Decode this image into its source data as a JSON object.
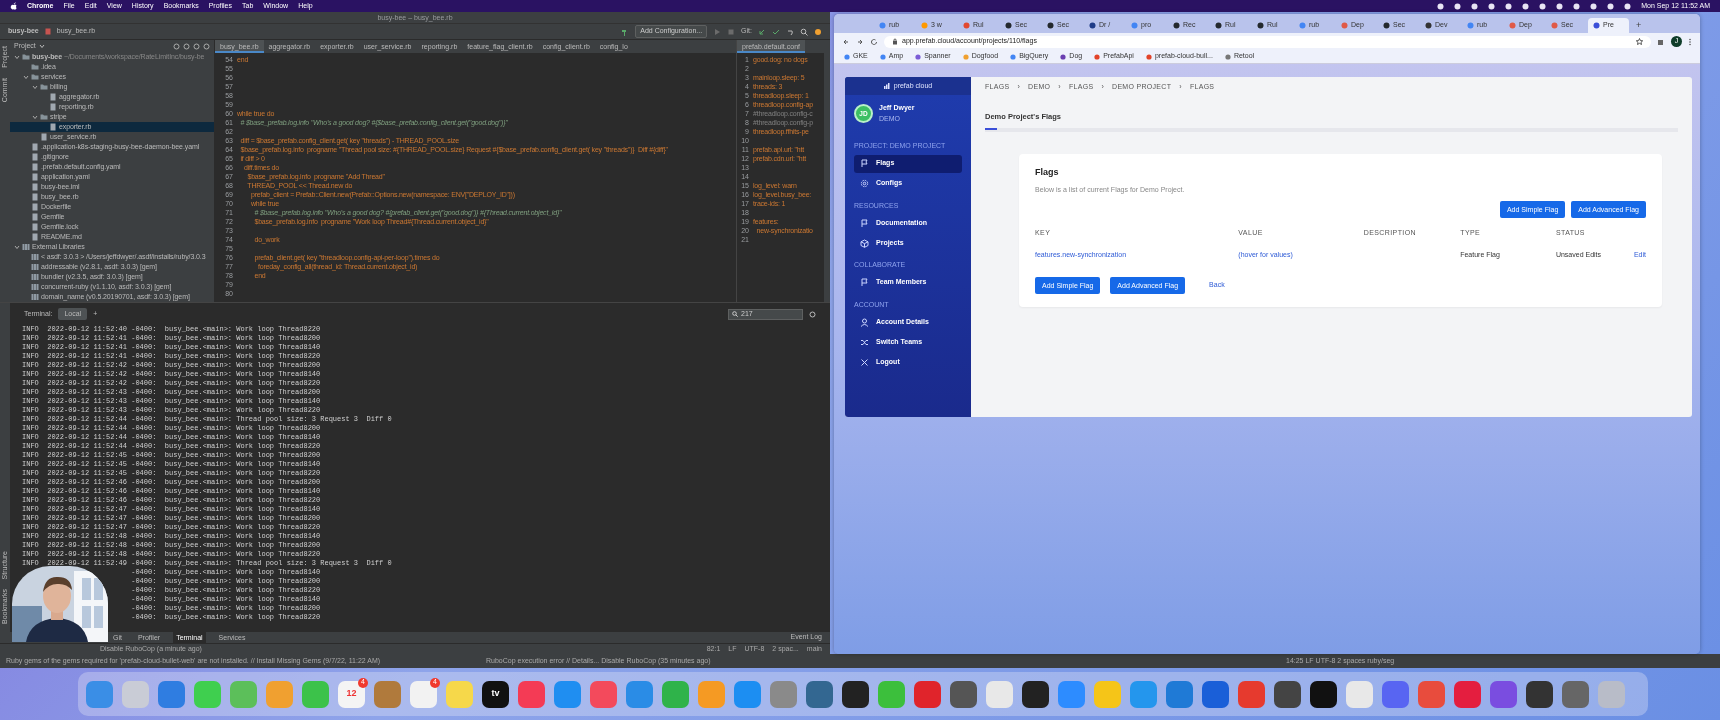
{
  "menu_bar": {
    "menus": [
      "Chrome",
      "File",
      "Edit",
      "View",
      "History",
      "Bookmarks",
      "Profiles",
      "Tab",
      "Window",
      "Help"
    ],
    "clock": "Mon Sep 12  11:52 AM"
  },
  "ide": {
    "title": "busy-bee – busy_bee.rb",
    "breadcrumb": [
      "busy-bee",
      "busy_bee.rb"
    ],
    "run_config": "Add Configuration...",
    "git_label": "Git:",
    "project_label": "Project",
    "side_tabs": [
      "Project",
      "Commit"
    ],
    "terminal_side_tabs": [
      "Structure",
      "Bookmarks"
    ],
    "tree": [
      {
        "label": "busy-bee",
        "path": "~/Documents/workspace/RateLimitInc/busy-be",
        "kind": "folder",
        "selected": false,
        "children": [
          {
            "label": ".idea",
            "kind": "folder",
            "selected": false
          },
          {
            "label": "services",
            "kind": "folder",
            "selected": false,
            "children": [
              {
                "label": "billing",
                "kind": "folder",
                "selected": false,
                "children": [
                  {
                    "label": "aggregator.rb",
                    "kind": "file",
                    "selected": false
                  },
                  {
                    "label": "reporting.rb",
                    "kind": "file",
                    "selected": false
                  }
                ]
              },
              {
                "label": "stripe",
                "kind": "folder",
                "selected": false,
                "children": [
                  {
                    "label": "exporter.rb",
                    "kind": "file",
                    "selected": true
                  }
                ]
              },
              {
                "label": "user_service.rb",
                "kind": "file",
                "selected": false
              }
            ]
          },
          {
            "label": ".application-k8s-staging-busy-bee-daemon-bee.yaml",
            "kind": "file",
            "selected": false
          },
          {
            "label": ".gitignore",
            "kind": "file",
            "selected": false
          },
          {
            "label": ".prefab.default.config.yaml",
            "kind": "file",
            "selected": false
          },
          {
            "label": "application.yaml",
            "kind": "file",
            "selected": false
          },
          {
            "label": "busy-bee.iml",
            "kind": "file",
            "selected": false
          },
          {
            "label": "busy_bee.rb",
            "kind": "file",
            "selected": false
          },
          {
            "label": "Dockerfile",
            "kind": "file",
            "selected": false
          },
          {
            "label": "Gemfile",
            "kind": "file",
            "selected": false
          },
          {
            "label": "Gemfile.lock",
            "kind": "file",
            "selected": false
          },
          {
            "label": "README.md",
            "kind": "file",
            "selected": false
          }
        ]
      },
      {
        "label": "External Libraries",
        "kind": "library",
        "selected": false,
        "children": [
          {
            "label": "< asdf: 3.0.3 > /Users/jeffdwyer/.asdf/installs/ruby/3.0.3",
            "kind": "library",
            "selected": false
          },
          {
            "label": "addressable (v2.8.1, asdf: 3.0.3) [gem]",
            "kind": "library",
            "selected": false
          },
          {
            "label": "bundler (v2.3.5, asdf: 3.0.3) [gem]",
            "kind": "library",
            "selected": false
          },
          {
            "label": "concurrent-ruby (v1.1.10, asdf: 3.0.3) [gem]",
            "kind": "library",
            "selected": false
          },
          {
            "label": "domain_name (v0.5.20190701, asdf: 3.0.3) [gem]",
            "kind": "library",
            "selected": false
          }
        ]
      }
    ],
    "editor_tabs": [
      {
        "label": "busy_bee.rb",
        "selected": true
      },
      {
        "label": "aggregator.rb",
        "selected": false
      },
      {
        "label": "exporter.rb",
        "selected": false
      },
      {
        "label": "user_service.rb",
        "selected": false
      },
      {
        "label": "reporting.rb",
        "selected": false
      },
      {
        "label": "feature_flag_client.rb",
        "selected": false
      },
      {
        "label": "config_client.rb",
        "selected": false
      },
      {
        "label": "config_lo",
        "selected": false
      }
    ],
    "code_lines": [
      {
        "n": "54",
        "text": "end",
        "kind": "code"
      },
      {
        "n": "55"
      },
      {
        "n": "56"
      },
      {
        "n": "57"
      },
      {
        "n": "58"
      },
      {
        "n": "59"
      },
      {
        "n": "60",
        "text": "while true do",
        "kind": "code"
      },
      {
        "n": "61",
        "text": "  # $base_prefab.log.info \"Who's a good dog? #{$base_prefab.config_client.get(\"good.dog\")}\"",
        "kind": "comment"
      },
      {
        "n": "62"
      },
      {
        "n": "63",
        "text": "  diff = $base_prefab.config_client.get( key \"threads\") - THREAD_POOL.size",
        "kind": "code"
      },
      {
        "n": "64",
        "text": "  $base_prefab.log.info  progname \"Thread pool size: #{THREAD_POOL.size} Request #{$base_prefab.config_client.get( key \"threads\")}  Diff #{diff}\"",
        "kind": "code"
      },
      {
        "n": "65",
        "text": "  if diff > 0",
        "kind": "code"
      },
      {
        "n": "66",
        "text": "    diff.times do",
        "kind": "code"
      },
      {
        "n": "67",
        "text": "      $base_prefab.log.info  progname \"Add Thread\"",
        "kind": "code"
      },
      {
        "n": "68",
        "text": "      THREAD_POOL << Thread.new do",
        "kind": "code"
      },
      {
        "n": "69",
        "text": "        prefab_client = Prefab::Client.new(Prefab::Options.new(namespace: ENV[\"DEPLOY_ID\"]))",
        "kind": "code"
      },
      {
        "n": "70",
        "text": "        while true",
        "kind": "code"
      },
      {
        "n": "71",
        "text": "          # $base_prefab.log.info \"Who's a good dog? #{prefab_client.get(\"good.dog\")} #{Thread.current.object_id}\"",
        "kind": "comment"
      },
      {
        "n": "72",
        "text": "          $base_prefab.log.info  progname \"Work loop Thread#{Thread.current.object_id}\"",
        "kind": "code"
      },
      {
        "n": "73"
      },
      {
        "n": "74",
        "text": "          do_work",
        "kind": "code"
      },
      {
        "n": "75"
      },
      {
        "n": "76",
        "text": "          prefab_client.get( key \"threadloop.config-api-per-loop\").times do",
        "kind": "code"
      },
      {
        "n": "77",
        "text": "            foreday_config_all(thread_id: Thread.current.object_id)",
        "kind": "code"
      },
      {
        "n": "78",
        "text": "          end",
        "kind": "code"
      },
      {
        "n": "79"
      },
      {
        "n": "80"
      }
    ],
    "yaml_tab": "prefab.default.conf",
    "yaml_lines": [
      {
        "n": "1",
        "text": "good.dog: no dogs",
        "kind": "code"
      },
      {
        "n": "2"
      },
      {
        "n": "3",
        "text": "mainloop.sleep: 5",
        "kind": "code"
      },
      {
        "n": "4",
        "text": "threads: 3",
        "kind": "code"
      },
      {
        "n": "5",
        "text": "threadloop.sleep: 1",
        "kind": "code"
      },
      {
        "n": "6",
        "text": "threadloop.config-ap",
        "kind": "code"
      },
      {
        "n": "7",
        "text": "#threadloop.config-c",
        "kind": "comment"
      },
      {
        "n": "8",
        "text": "#threadloop.config-p",
        "kind": "comment"
      },
      {
        "n": "9",
        "text": "threadloop.ffhits-pe",
        "kind": "code"
      },
      {
        "n": "10"
      },
      {
        "n": "11",
        "text": "prefab.api.url: \"htt",
        "kind": "code"
      },
      {
        "n": "12",
        "text": "prefab.cdn.url: \"htt",
        "kind": "code"
      },
      {
        "n": "13"
      },
      {
        "n": "14"
      },
      {
        "n": "15",
        "text": "log_level: warn",
        "kind": "code"
      },
      {
        "n": "16",
        "text": "log_level.busy_bee:",
        "kind": "code"
      },
      {
        "n": "17",
        "text": "trace-ids: 1",
        "kind": "code"
      },
      {
        "n": "18"
      },
      {
        "n": "19",
        "text": "features:",
        "kind": "code"
      },
      {
        "n": "20",
        "text": "  new-synchronizatio",
        "kind": "code"
      },
      {
        "n": "21"
      }
    ],
    "terminal": {
      "title": "Terminal:",
      "tab": "Local",
      "new_tab": "+",
      "search": "217",
      "lines": [
        {
          "text": "INFO  2022-09-12 11:52:40 -0400:  busy_bee.<main>: Work loop Thread8220",
          "kind": "log"
        },
        {
          "text": "INFO  2022-09-12 11:52:41 -0400:  busy_bee.<main>: Work loop Thread8200",
          "kind": "log"
        },
        {
          "text": "INFO  2022-09-12 11:52:41 -0400:  busy_bee.<main>: Work loop Thread8140",
          "kind": "log"
        },
        {
          "text": "INFO  2022-09-12 11:52:41 -0400:  busy_bee.<main>: Work loop Thread8220",
          "kind": "log"
        },
        {
          "text": "INFO  2022-09-12 11:52:42 -0400:  busy_bee.<main>: Work loop Thread8200",
          "kind": "log"
        },
        {
          "text": "INFO  2022-09-12 11:52:42 -0400:  busy_bee.<main>: Work loop Thread8140",
          "kind": "log"
        },
        {
          "text": "INFO  2022-09-12 11:52:42 -0400:  busy_bee.<main>: Work loop Thread8220",
          "kind": "log"
        },
        {
          "text": "INFO  2022-09-12 11:52:43 -0400:  busy_bee.<main>: Work loop Thread8200",
          "kind": "log"
        },
        {
          "text": "INFO  2022-09-12 11:52:43 -0400:  busy_bee.<main>: Work loop Thread8140",
          "kind": "log"
        },
        {
          "text": "INFO  2022-09-12 11:52:43 -0400:  busy_bee.<main>: Work loop Thread8220",
          "kind": "log"
        },
        {
          "text": "INFO  2022-09-12 11:52:44 -0400:  busy_bee.<main>: Thread pool size: 3 Request 3  Diff 0",
          "kind": "log"
        },
        {
          "text": "INFO  2022-09-12 11:52:44 -0400:  busy_bee.<main>: Work loop Thread8200",
          "kind": "log"
        },
        {
          "text": "INFO  2022-09-12 11:52:44 -0400:  busy_bee.<main>: Work loop Thread8140",
          "kind": "log"
        },
        {
          "text": "INFO  2022-09-12 11:52:44 -0400:  busy_bee.<main>: Work loop Thread8220",
          "kind": "log"
        },
        {
          "text": "INFO  2022-09-12 11:52:45 -0400:  busy_bee.<main>: Work loop Thread8200",
          "kind": "log"
        },
        {
          "text": "INFO  2022-09-12 11:52:45 -0400:  busy_bee.<main>: Work loop Thread8140",
          "kind": "log"
        },
        {
          "text": "INFO  2022-09-12 11:52:45 -0400:  busy_bee.<main>: Work loop Thread8220",
          "kind": "log"
        },
        {
          "text": "INFO  2022-09-12 11:52:46 -0400:  busy_bee.<main>: Work loop Thread8200",
          "kind": "log"
        },
        {
          "text": "INFO  2022-09-12 11:52:46 -0400:  busy_bee.<main>: Work loop Thread8140",
          "kind": "log"
        },
        {
          "text": "INFO  2022-09-12 11:52:46 -0400:  busy_bee.<main>: Work loop Thread8220",
          "kind": "log"
        },
        {
          "text": "INFO  2022-09-12 11:52:47 -0400:  busy_bee.<main>: Work loop Thread8140",
          "kind": "log"
        },
        {
          "text": "INFO  2022-09-12 11:52:47 -0400:  busy_bee.<main>: Work loop Thread8200",
          "kind": "log"
        },
        {
          "text": "INFO  2022-09-12 11:52:47 -0400:  busy_bee.<main>: Work loop Thread8220",
          "kind": "log"
        },
        {
          "text": "INFO  2022-09-12 11:52:48 -0400:  busy_bee.<main>: Work loop Thread8140",
          "kind": "log"
        },
        {
          "text": "INFO  2022-09-12 11:52:48 -0400:  busy_bee.<main>: Work loop Thread8200",
          "kind": "log"
        },
        {
          "text": "INFO  2022-09-12 11:52:48 -0400:  busy_bee.<main>: Work loop Thread8220",
          "kind": "log"
        },
        {
          "text": "INFO  2022-09-12 11:52:49 -0400:  busy_bee.<main>: Thread pool size: 3 Request 3  Diff 0",
          "kind": "log"
        },
        {
          "text": "-0400:  busy_bee.<main>: Work loop Thread8140",
          "kind": "covered"
        },
        {
          "text": "-0400:  busy_bee.<main>: Work loop Thread8200",
          "kind": "covered"
        },
        {
          "text": "-0400:  busy_bee.<main>: Work loop Thread8220",
          "kind": "covered"
        },
        {
          "text": "-0400:  busy_bee.<main>: Work loop Thread8140",
          "kind": "covered"
        },
        {
          "text": "-0400:  busy_bee.<main>: Work loop Thread8200",
          "kind": "covered"
        },
        {
          "text": "-0400:  busy_bee.<main>: Work loop Thread8220",
          "kind": "covered"
        }
      ]
    },
    "tool_tabs": [
      {
        "label": "Git",
        "selected": false
      },
      {
        "label": "Profiler",
        "selected": false
      },
      {
        "label": "Terminal",
        "selected": true
      },
      {
        "label": "Services",
        "selected": false
      }
    ],
    "event_log": "Event Log",
    "status": {
      "message": "Disable RuboCop (a minute ago)",
      "items": [
        "82:1",
        "LF",
        "UTF-8",
        "2 spac...",
        "main"
      ]
    }
  },
  "background_window_status": {
    "left": "Ruby gems of the gems required for 'prefab-cloud-bullet-web' are not installed. // Install Missing Gems (9/7/22, 11:22 AM)",
    "middle": "RuboCop execution error // Details... Disable RuboCop (35 minutes ago)",
    "right": "14:25  LF  UTF-8  2 spaces  ruby/seg"
  },
  "browser": {
    "tabs": [
      {
        "label": "rub",
        "selected": false
      },
      {
        "label": "3 w",
        "selected": false
      },
      {
        "label": "Rul",
        "selected": false
      },
      {
        "label": "Sec",
        "selected": false
      },
      {
        "label": "Sec",
        "selected": false
      },
      {
        "label": "Dr /",
        "selected": false
      },
      {
        "label": "pro",
        "selected": false
      },
      {
        "label": "Rec",
        "selected": false
      },
      {
        "label": "Rul",
        "selected": false
      },
      {
        "label": "Rul",
        "selected": false
      },
      {
        "label": "rub",
        "selected": false
      },
      {
        "label": "Dep",
        "selected": false
      },
      {
        "label": "Sec",
        "selected": false
      },
      {
        "label": "Dev",
        "selected": false
      },
      {
        "label": "rub",
        "selected": false
      },
      {
        "label": "Dep",
        "selected": false
      },
      {
        "label": "Sec",
        "selected": false
      },
      {
        "label": "Pre",
        "selected": true
      }
    ],
    "new_tab": "+",
    "url": "app.prefab.cloud/account/projects/110/flags",
    "profile_initial": "J",
    "bookmarks": [
      "GKE",
      "Amp",
      "Spanner",
      "Dogfood",
      "BigQuery",
      "Dog",
      "PrefabApi",
      "prefab-cloud-bull...",
      "Retool"
    ]
  },
  "app": {
    "logo": "prefab cloud",
    "user": {
      "name": "Jeff Dwyer",
      "team": "DEMO",
      "initials": "JD"
    },
    "sections": [
      {
        "title": "PROJECT: DEMO PROJECT",
        "items": [
          {
            "label": "Flags",
            "selected": true
          },
          {
            "label": "Configs",
            "selected": false
          }
        ]
      },
      {
        "title": "RESOURCES",
        "items": [
          {
            "label": "Documentation",
            "selected": false
          },
          {
            "label": "Projects",
            "selected": false
          }
        ]
      },
      {
        "title": "COLLABORATE",
        "items": [
          {
            "label": "Team Members",
            "selected": false
          }
        ]
      },
      {
        "title": "ACCOUNT",
        "items": [
          {
            "label": "Account Details",
            "selected": false
          },
          {
            "label": "Switch Teams",
            "selected": false
          },
          {
            "label": "Logout",
            "selected": false
          }
        ]
      }
    ],
    "breadcrumb": [
      "FLAGS",
      "DEMO",
      "FLAGS",
      "DEMO PROJECT",
      "FLAGS"
    ],
    "breadcrumb_separator": "›",
    "page_title": "Demo Project's Flags",
    "card": {
      "title": "Flags",
      "subtitle": "Below is a list of current Flags for Demo Project.",
      "top_buttons": [
        {
          "label": "Add Simple Flag",
          "kind": "primary"
        },
        {
          "label": "Add Advanced Flag",
          "kind": "primary"
        }
      ],
      "columns": [
        "KEY",
        "VALUE",
        "DESCRIPTION",
        "TYPE",
        "STATUS"
      ],
      "rows": [
        {
          "key": "features.new-synchronization",
          "value": "(hover for values)",
          "type": "Feature Flag",
          "status": "Unsaved Edits",
          "action": "Edit"
        }
      ],
      "bottom_buttons": [
        {
          "label": "Add Simple Flag",
          "kind": "primary"
        },
        {
          "label": "Add Advanced Flag",
          "kind": "primary"
        },
        {
          "label": "Back",
          "kind": "link"
        }
      ]
    }
  },
  "dock": [
    {
      "color": "#3a8ee6"
    },
    {
      "color": "#c9ccd6"
    },
    {
      "color": "#2f7de1"
    },
    {
      "color": "#3fcf4f"
    },
    {
      "color": "#5cbf5a"
    },
    {
      "color": "#f0a030"
    },
    {
      "color": "#3cc24a"
    },
    {
      "color": "#f4f4f4",
      "label": "12",
      "badge": "4"
    },
    {
      "color": "#b07a3c"
    },
    {
      "color": "#f2f2f2",
      "badge": "4"
    },
    {
      "color": "#f6d84a"
    },
    {
      "color": "#111111",
      "label": "tv"
    },
    {
      "color": "#f43b55"
    },
    {
      "color": "#1f8ef1"
    },
    {
      "color": "#f34a5c"
    },
    {
      "color": "#2a8ce6"
    },
    {
      "color": "#2fb34a"
    },
    {
      "color": "#f59a23"
    },
    {
      "color": "#1c8ef2"
    },
    {
      "color": "#8a8a8a"
    },
    {
      "color": "#336791"
    },
    {
      "color": "#222222"
    },
    {
      "color": "#3cbf3c"
    },
    {
      "color": "#e0242b"
    },
    {
      "color": "#555555"
    },
    {
      "color": "#e8e8e8"
    },
    {
      "color": "#222222"
    },
    {
      "color": "#2d8cff"
    },
    {
      "color": "#f5c518"
    },
    {
      "color": "#2496ed"
    },
    {
      "color": "#1f7ad6"
    },
    {
      "color": "#1a5fd8"
    },
    {
      "color": "#e63a2e"
    },
    {
      "color": "#444444"
    },
    {
      "color": "#111111"
    },
    {
      "color": "#e8e8e8"
    },
    {
      "color": "#5865f2"
    },
    {
      "color": "#e84c3d"
    },
    {
      "color": "#e41e3f"
    },
    {
      "color": "#7a4de0"
    },
    {
      "color": "#333333"
    },
    {
      "color": "#666666"
    },
    {
      "color": "#b8bcc8"
    }
  ]
}
